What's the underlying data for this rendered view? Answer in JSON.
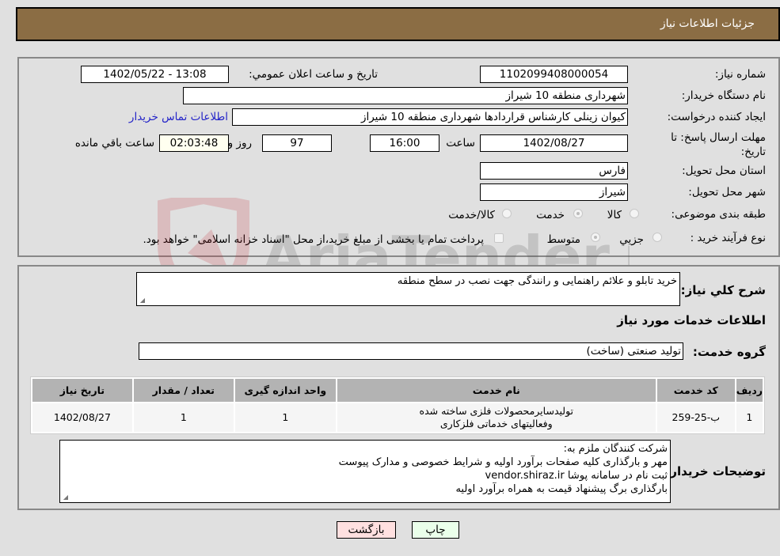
{
  "header": {
    "title": "جزئیات اطلاعات نیاز"
  },
  "details": {
    "need_number_label": "شماره نیاز:",
    "need_number": "1102099408000054",
    "announce_label": "تاریخ و ساعت اعلان عمومي:",
    "announce_value": "1402/05/22 - 13:08",
    "buyer_org_label": "نام دستگاه خریدار:",
    "buyer_org": "شهرداری منطقه 10 شیراز",
    "creator_label": "ایجاد کننده درخواست:",
    "creator": "کیوان زینلی کارشناس قراردادها شهرداری منطقه 10 شیراز",
    "contact_link": "اطلاعات تماس خریدار",
    "deadline_label_line1": "مهلت ارسال پاسخ: تا",
    "deadline_label_line2": "تاریخ:",
    "deadline_date": "1402/08/27",
    "time_label": "ساعت",
    "deadline_time": "16:00",
    "days_value": "97",
    "days_label": "روز و",
    "remaining_time": "02:03:48",
    "remaining_label": "ساعت باقي مانده",
    "province_label": "استان محل تحویل:",
    "province": "فارس",
    "city_label": "شهر محل تحویل:",
    "city": "شیراز",
    "category_label": "طبقه بندی موضوعی:",
    "category_options": [
      {
        "label": "کالا",
        "selected": false
      },
      {
        "label": "خدمت",
        "selected": true
      },
      {
        "label": "کالا/خدمت",
        "selected": false
      }
    ],
    "process_label": "نوع فرآیند خرید :",
    "process_options": [
      {
        "label": "جزيي",
        "selected": false
      },
      {
        "label": "متوسط",
        "selected": true
      }
    ],
    "treasury_checkbox_label": "پرداخت تمام یا بخشی از مبلغ خرید،از محل \"اسناد خزانه اسلامی\" خواهد بود.",
    "treasury_checked": false
  },
  "need": {
    "summary_label": "شرح کلي نیاز:",
    "summary": "خرید تابلو و علائم راهنمایی و رانندگی جهت نصب در سطح منطقه",
    "services_title": "اطلاعات خدمات مورد نیاز",
    "service_group_label": "گروه خدمت:",
    "service_group": "تولید صنعتی (ساخت)"
  },
  "table": {
    "headers": [
      "ردیف",
      "کد خدمت",
      "نام خدمت",
      "واحد اندازه گیری",
      "تعداد / مقدار",
      "تاریخ نیاز"
    ],
    "rows": [
      [
        "1",
        "ب-25-259",
        "تولیدسایرمحصولات فلزی ساخته شده وفعالیتهای خدماتی فلزکاری",
        "1",
        "1",
        "1402/08/27"
      ]
    ]
  },
  "buyer_notes": {
    "label": "توضیحات خریدار:",
    "lines": [
      "شرکت کنندگان ملزم به:",
      "مهر و بارگذاری کلیه صفحات برآورد اولیه و شرایط خصوصی و مدارک پیوست",
      "ثبت نام در سامانه پوشا vendor.shiraz.ir",
      "بارگذاری برگ پیشنهاد قیمت به همراه برآورد اولیه"
    ]
  },
  "buttons": {
    "print": "چاپ",
    "back": "بازگشت"
  },
  "watermark": {
    "text": "AriaTender.neT"
  },
  "colors": {
    "header_bg": "#8b6d44",
    "print_bg": "#eaffea",
    "back_bg": "#ffe0e0",
    "link": "#2323c8"
  }
}
